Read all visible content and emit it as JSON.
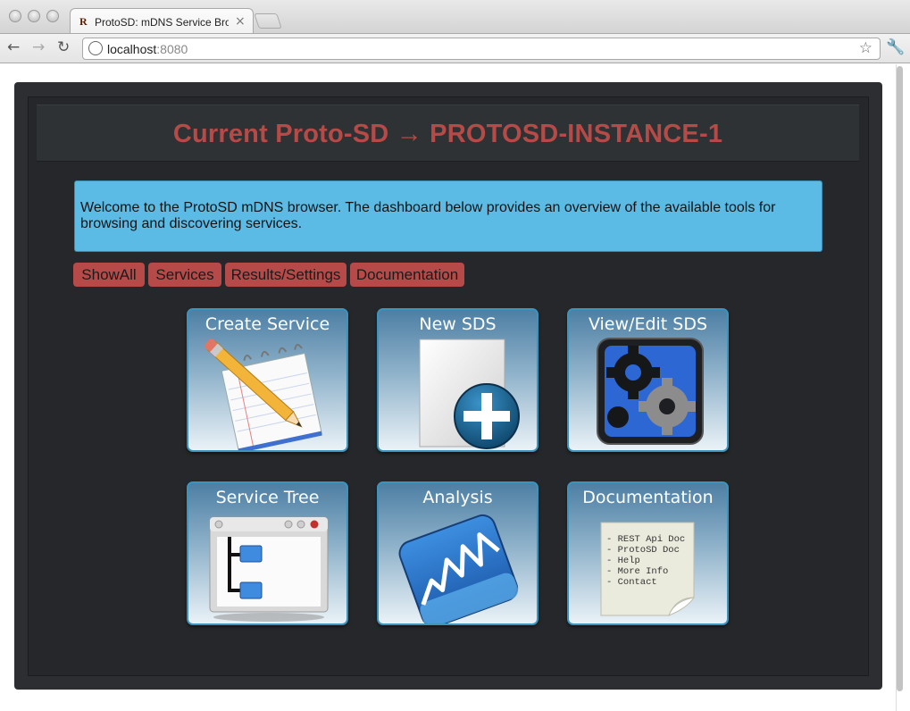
{
  "browser": {
    "tab_title": "ProtoSD: mDNS Service Browser",
    "tab_favicon": "R",
    "tab_close": "×",
    "url_host": "localhost",
    "url_port": ":8080",
    "icons": [
      "back-icon",
      "forward-icon",
      "reload-icon",
      "globe-icon",
      "star-icon",
      "wrench-icon"
    ]
  },
  "page": {
    "title": "Current Proto-SD → PROTOSD-INSTANCE-1",
    "welcome": "Welcome to the ProtoSD mDNS browser. The dashboard below provides an overview of the available tools for browsing and discovering services.",
    "nav": [
      {
        "label": "ShowAll"
      },
      {
        "label": "Services"
      },
      {
        "label": "Results/Settings"
      },
      {
        "label": "Documentation"
      }
    ],
    "tiles": [
      {
        "label": "Create Service",
        "icon": "notepad-pencil-icon"
      },
      {
        "label": "New SDS",
        "icon": "new-document-plus-icon"
      },
      {
        "label": "View/Edit SDS",
        "icon": "gears-icon"
      },
      {
        "label": "Service Tree",
        "icon": "tree-window-icon"
      },
      {
        "label": "Analysis",
        "icon": "analysis-graph-icon"
      },
      {
        "label": "Documentation",
        "icon": "document-note-icon",
        "doc_lines": [
          "- REST Api Doc",
          "- ProtoSD Doc",
          "- Help",
          "- More Info",
          "- Contact"
        ]
      }
    ]
  },
  "colors": {
    "title_red": "#b64a46",
    "button_red": "#b64a48",
    "welcome_blue": "#5bbbe4",
    "panel_dark": "#25272a"
  }
}
